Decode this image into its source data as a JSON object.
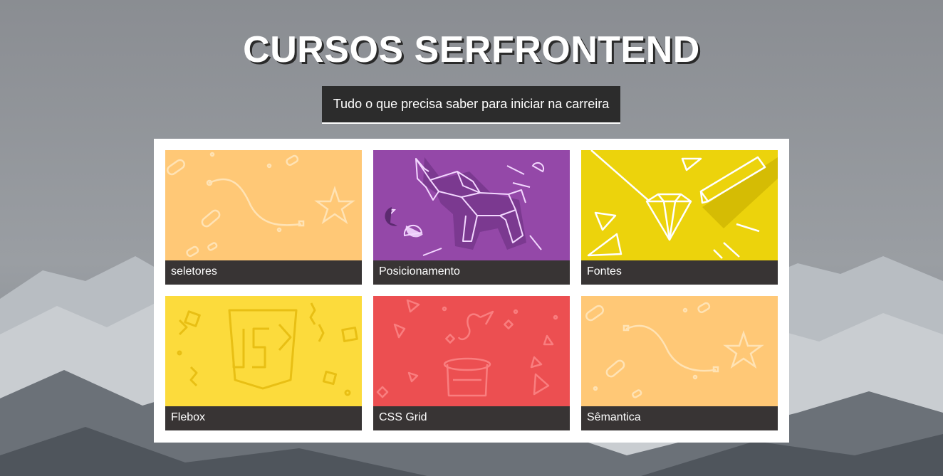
{
  "header": {
    "title": "CURSOS SERFRONTEND",
    "subtitle": "Tudo o que precisa saber para iniciar na carreira"
  },
  "courses": [
    {
      "label": "seletores",
      "color": "#ffc876",
      "icon": "star-path-icon"
    },
    {
      "label": "Posicionamento",
      "color": "#9448a8",
      "icon": "origami-elephant-icon"
    },
    {
      "label": "Fontes",
      "color": "#ecd30c",
      "icon": "diamond-pencil-icon"
    },
    {
      "label": "Flebox",
      "color": "#fcdb3c",
      "icon": "js-shield-icon"
    },
    {
      "label": "CSS Grid",
      "color": "#ec4f51",
      "icon": "magic-hat-icon"
    },
    {
      "label": "Sêmantica",
      "color": "#ffc876",
      "icon": "star-path-icon"
    }
  ],
  "colors": {
    "title_shadow": "#2a2a2a",
    "label_bar": "#383434",
    "subtitle_bg": "#2c2c2c"
  }
}
